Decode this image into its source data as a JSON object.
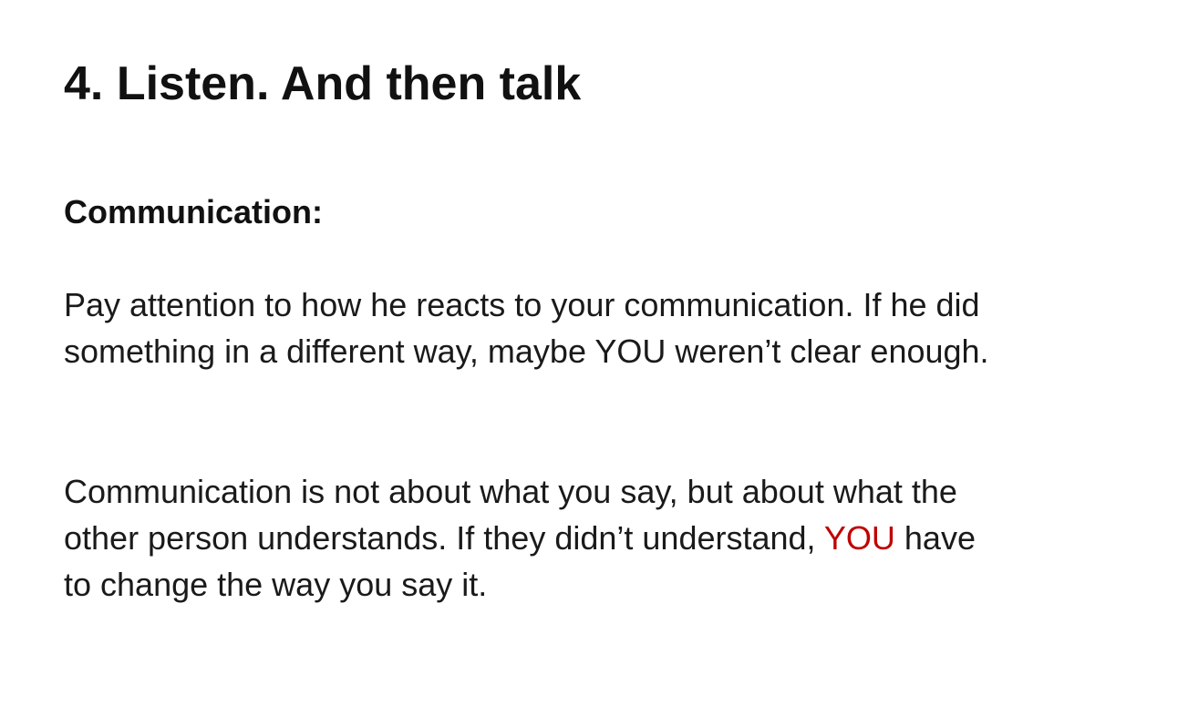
{
  "title": "4. Listen. And then talk",
  "subtitle": "Communication:",
  "paragraph1": {
    "line1": "Pay attention to how he reacts to your communication. If he did",
    "line2": "something in a different way, maybe YOU weren’t clear enough."
  },
  "paragraph2": {
    "line1": "Communication is not about what you say, but about what the",
    "line2_before": "other person understands. If they didn’t understand, ",
    "line2_highlight": "YOU",
    "line2_after": " have",
    "line3": "to change the way you say it."
  },
  "colors": {
    "highlight": "#c00000",
    "text": "#1a1a1a",
    "background": "#ffffff"
  }
}
